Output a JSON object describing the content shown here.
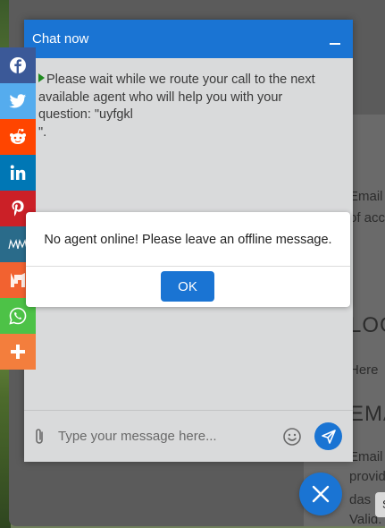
{
  "chat": {
    "title": "Chat now",
    "message_line1": "Please wait while we route your call to the next",
    "message_line2": "available agent who will help you with your",
    "message_line3": "question: \"uyfgkl",
    "message_line4": "\".",
    "input_placeholder": "Type your message here..."
  },
  "modal": {
    "text": "No agent online! Please leave an offline message.",
    "ok_label": "OK"
  },
  "background_page": {
    "text1": "Email",
    "text2": "of acc",
    "heading1": "LOG",
    "text3": "Here",
    "heading2": "EMA",
    "text4": "Email",
    "text5": "provid",
    "text6": "das",
    "text7": "Valid.",
    "badge": "S"
  },
  "social": [
    {
      "name": "facebook-icon",
      "color": "#3b5998"
    },
    {
      "name": "twitter-icon",
      "color": "#55acee"
    },
    {
      "name": "reddit-icon",
      "color": "#ff4500"
    },
    {
      "name": "linkedin-icon",
      "color": "#0077b5"
    },
    {
      "name": "pinterest-icon",
      "color": "#cb2027"
    },
    {
      "name": "meneame-icon",
      "color": "#2a6b8a"
    },
    {
      "name": "mix-icon",
      "color": "#f26230"
    },
    {
      "name": "whatsapp-icon",
      "color": "#4dc247"
    },
    {
      "name": "more-icon",
      "color": "#f37e3d"
    }
  ],
  "colors": {
    "accent": "#1a74d3",
    "chat_bg": "#d9dadb"
  }
}
